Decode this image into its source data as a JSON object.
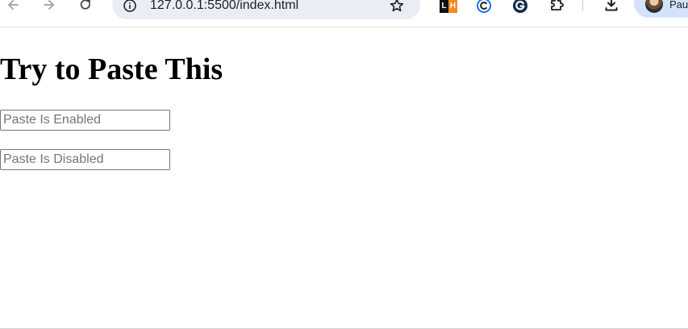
{
  "browser": {
    "url": "127.0.0.1:5500/index.html",
    "profile_name": "Pau",
    "icons": {
      "back": "arrow-left-icon",
      "forward": "arrow-right-icon",
      "reload": "reload-icon",
      "site_info": "info-icon",
      "bookmark": "star-icon",
      "ext_lh": "lh-extension-icon",
      "ext_c": "c-extension-icon",
      "ext_g": "g-extension-icon",
      "extensions": "puzzle-icon",
      "downloads": "download-icon",
      "avatar": "profile-avatar"
    },
    "ext_lh_letters": [
      "L",
      "H"
    ]
  },
  "page": {
    "heading": "Try to Paste This",
    "inputs": [
      {
        "placeholder": "Paste Is Enabled",
        "value": ""
      },
      {
        "placeholder": "Paste Is Disabled",
        "value": ""
      }
    ]
  },
  "colors": {
    "omnibox_bg": "#e9eef6",
    "profile_chip_bg": "#d3e3fd",
    "icon": "#474747",
    "ext_c_color": "#1a73e8",
    "ext_g_color": "#15294a",
    "ext_h_color": "#f08a24"
  }
}
